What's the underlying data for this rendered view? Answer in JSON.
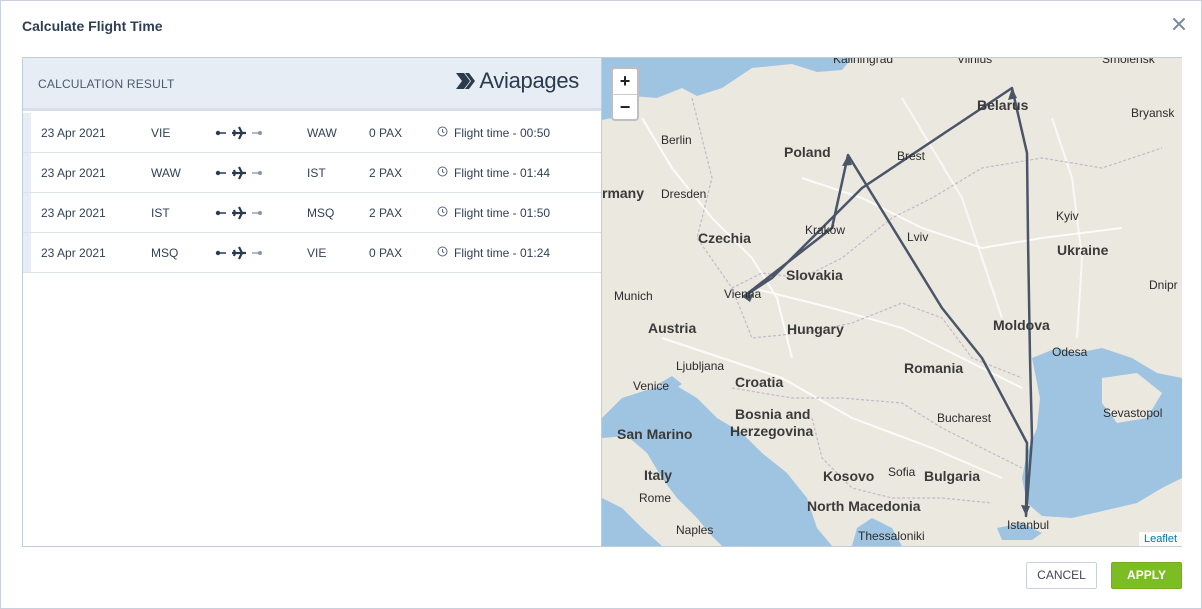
{
  "dialog": {
    "title": "Calculate Flight Time",
    "close_icon": "close-icon"
  },
  "result": {
    "header": "CALCULATION RESULT",
    "brand": "Aviapages",
    "rows": [
      {
        "date": "23 Apr 2021",
        "from": "VIE",
        "to": "WAW",
        "pax": "0 PAX",
        "time": "Flight time - 00:50"
      },
      {
        "date": "23 Apr 2021",
        "from": "WAW",
        "to": "IST",
        "pax": "2 PAX",
        "time": "Flight time - 01:44"
      },
      {
        "date": "23 Apr 2021",
        "from": "IST",
        "to": "MSQ",
        "pax": "2 PAX",
        "time": "Flight time - 01:50"
      },
      {
        "date": "23 Apr 2021",
        "from": "MSQ",
        "to": "VIE",
        "pax": "0 PAX",
        "time": "Flight time - 01:24"
      }
    ]
  },
  "map": {
    "zoom_in": "+",
    "zoom_out": "−",
    "attribution": "Leaflet",
    "labels": {
      "kaliningrad": "Kaliningrad",
      "vilnius": "Vilnius",
      "smolensk": "Smolensk",
      "belarus": "Belarus",
      "bryansk": "Bryansk",
      "berlin": "Berlin",
      "poland": "Poland",
      "brest": "Brest",
      "germany": "rmany",
      "dresden": "Dresden",
      "krakow": "Kraków",
      "kyiv": "Kyiv",
      "czechia": "Czechia",
      "lviv": "Lviv",
      "ukraine": "Ukraine",
      "slovakia": "Slovakia",
      "munich": "Munich",
      "vienna": "Vienna",
      "dnipro": "Dnipr",
      "austria": "Austria",
      "hungary": "Hungary",
      "moldova": "Moldova",
      "ljubljana": "Ljubljana",
      "odesa": "Odesa",
      "venice": "Venice",
      "croatia": "Croatia",
      "romania": "Romania",
      "bosnia1": "Bosnia and",
      "bosnia2": "Herzegovina",
      "bucharest": "Bucharest",
      "sevastopol": "Sevastopol",
      "sanmarino": "San Marino",
      "italy": "Italy",
      "kosovo": "Kosovo",
      "sofia": "Sofia",
      "bulgaria": "Bulgaria",
      "rome": "Rome",
      "northmacedonia": "North Macedonia",
      "naples": "Naples",
      "thessaloniki": "Thessaloniki",
      "istanbul": "Istanbul"
    },
    "route_color": "#4a5568"
  },
  "footer": {
    "cancel": "CANCEL",
    "apply": "APPLY",
    "apply_color": "#7cbd24"
  }
}
